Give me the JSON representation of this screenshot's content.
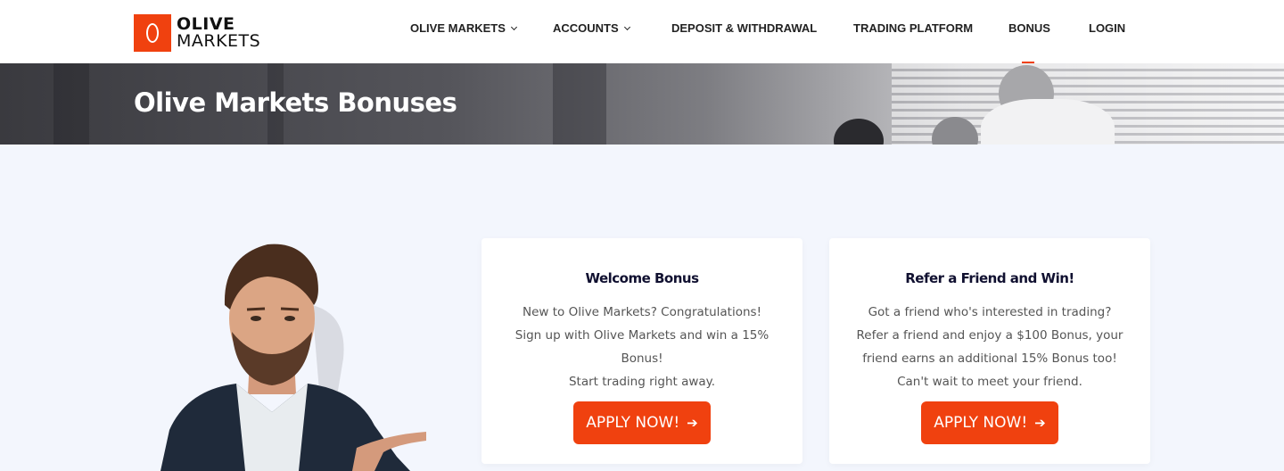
{
  "brand": {
    "line1": "OLIVE",
    "line2": "MARKETS",
    "accent_color": "#f0410f"
  },
  "nav": {
    "items": [
      {
        "label": "OLIVE MARKETS",
        "has_dropdown": true
      },
      {
        "label": "ACCOUNTS",
        "has_dropdown": true
      },
      {
        "label": "DEPOSIT & WITHDRAWAL",
        "has_dropdown": false
      },
      {
        "label": "TRADING PLATFORM",
        "has_dropdown": false
      },
      {
        "label": "BONUS",
        "has_dropdown": false,
        "active": true
      },
      {
        "label": "LOGIN",
        "has_dropdown": false
      }
    ]
  },
  "hero": {
    "title": "Olive Markets Bonuses"
  },
  "cards": [
    {
      "title": "Welcome Bonus",
      "lines": [
        "New to Olive Markets? Congratulations!",
        "Sign up with Olive Markets and win a 15%",
        "Bonus!",
        "Start trading right away."
      ],
      "button_label": "APPLY NOW!"
    },
    {
      "title": "Refer a Friend and Win!",
      "lines": [
        "Got a friend who's interested in trading?",
        "Refer a friend and enjoy a $100 Bonus, your",
        "friend earns an additional 15% Bonus too!",
        "Can't wait to meet your friend."
      ],
      "button_label": "APPLY NOW!"
    }
  ],
  "icons": {
    "arrow": "arrow-right-icon",
    "chevron": "chevron-down-icon"
  }
}
